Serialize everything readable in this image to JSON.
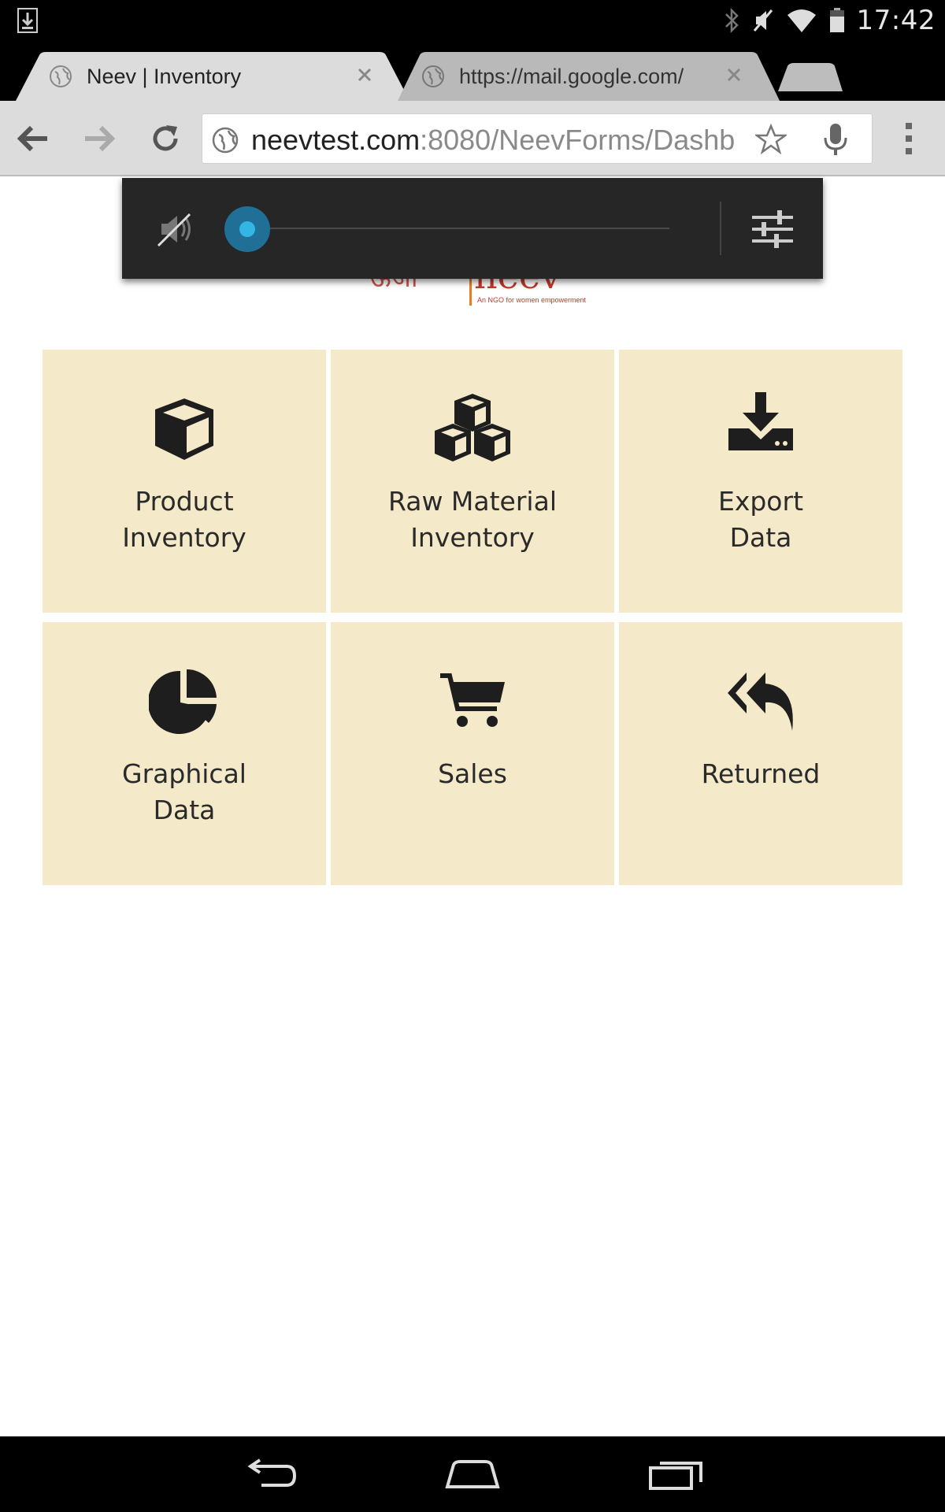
{
  "status_bar": {
    "time": "17:42",
    "icons": [
      "download-icon",
      "bluetooth-icon",
      "mute-icon",
      "wifi-icon",
      "battery-icon"
    ]
  },
  "tabs": [
    {
      "title": "Neev | Inventory",
      "active": true
    },
    {
      "title": "https://mail.google.com/",
      "active": false
    }
  ],
  "toolbar": {
    "url_host": "neevtest.com",
    "url_rest": ":8080/NeevForms/Dashb"
  },
  "volume_overlay": {
    "level": 0
  },
  "logo": {
    "alt": "Neev logo",
    "text": "neev",
    "tagline": "An NGO for women empowerment"
  },
  "tiles": [
    {
      "icon": "cube-icon",
      "line1": "Product",
      "line2": "Inventory"
    },
    {
      "icon": "cubes-icon",
      "line1": "Raw Material",
      "line2": "Inventory"
    },
    {
      "icon": "download-tray-icon",
      "line1": "Export",
      "line2": "Data"
    },
    {
      "icon": "pie-chart-icon",
      "line1": "Graphical",
      "line2": "Data"
    },
    {
      "icon": "shopping-cart-icon",
      "line1": "Sales",
      "line2": ""
    },
    {
      "icon": "reply-all-icon",
      "line1": "Returned",
      "line2": ""
    }
  ],
  "colors": {
    "tile_bg": "#f4e9c8",
    "accent": "#33b5e5"
  }
}
